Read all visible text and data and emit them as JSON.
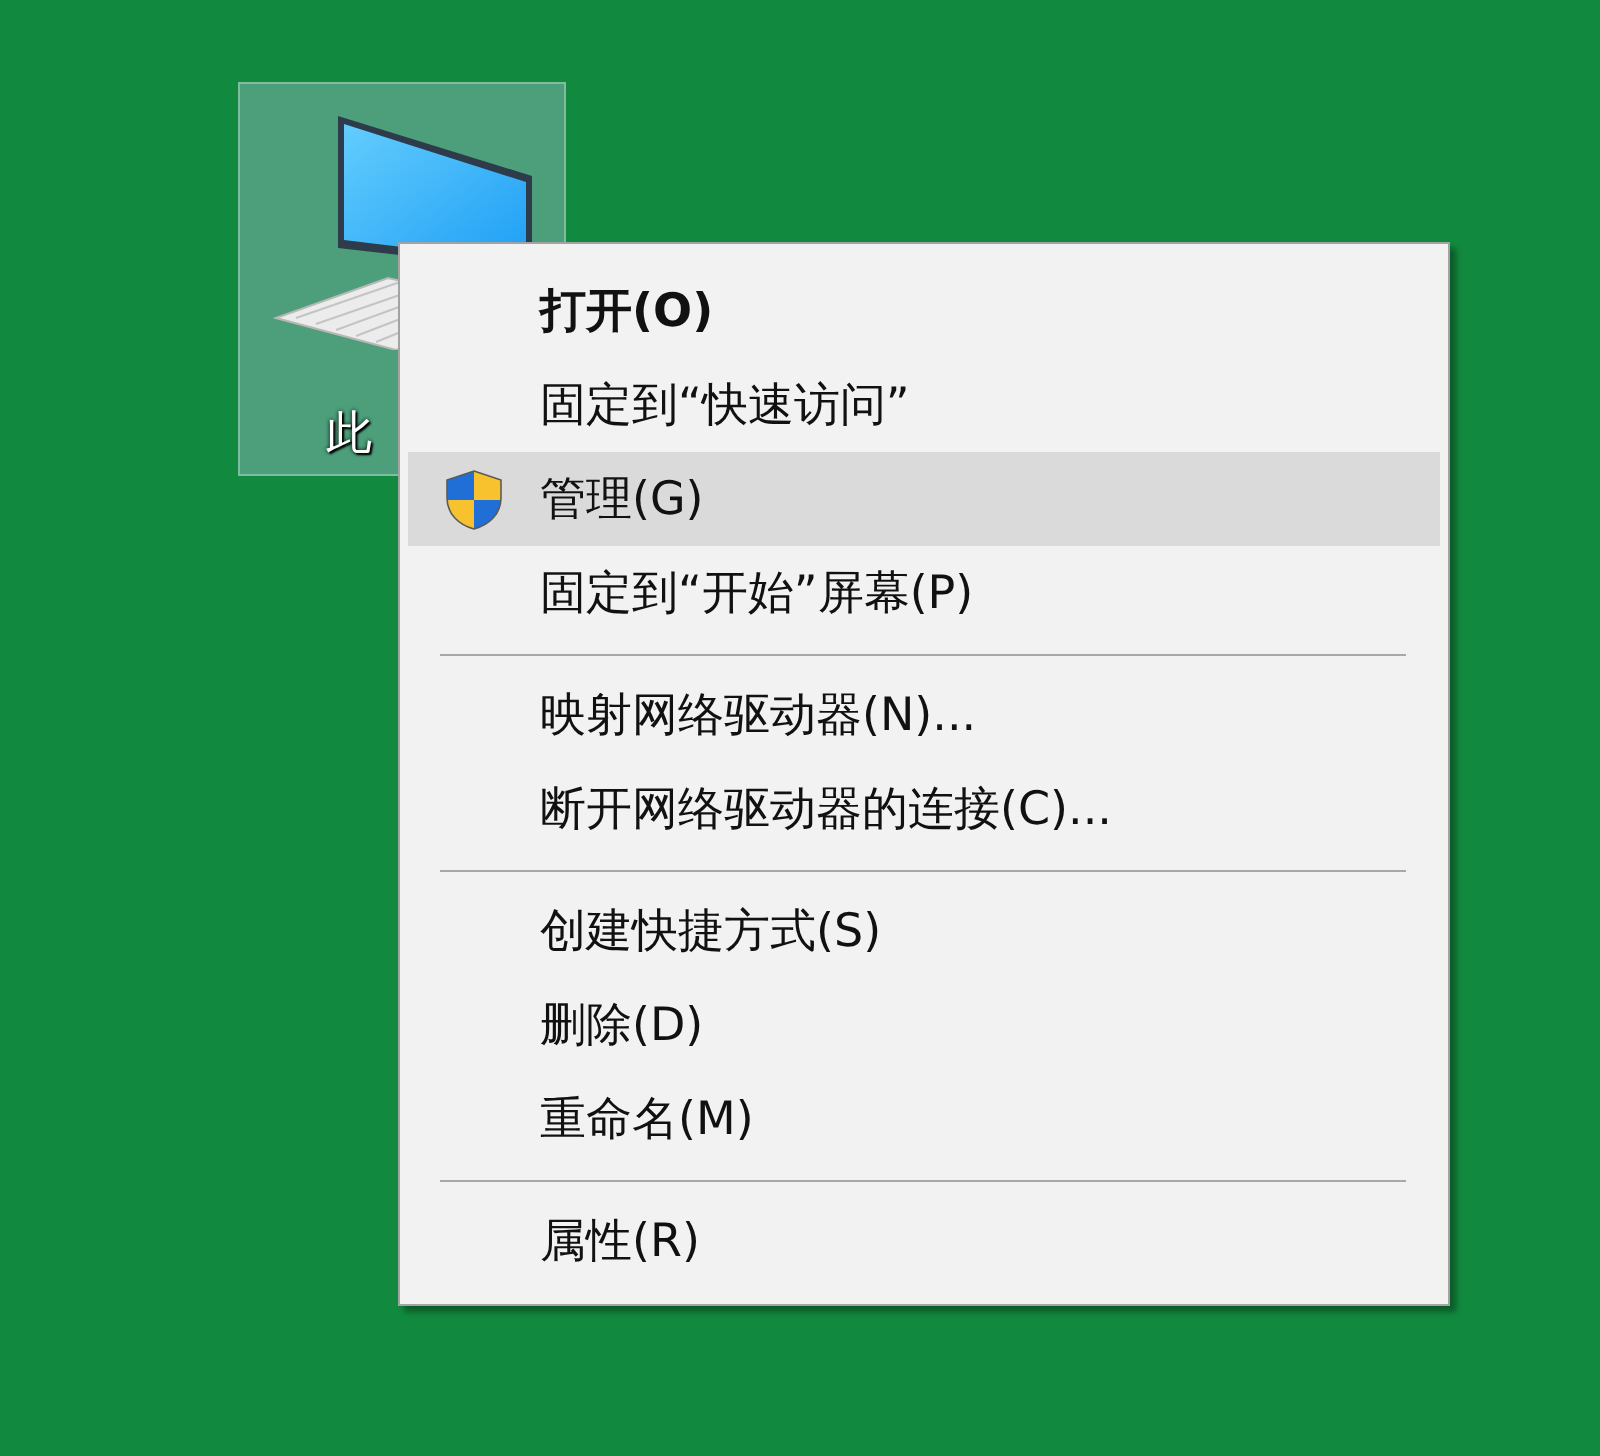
{
  "desktop": {
    "icons": [
      {
        "label": "此",
        "selected": true
      }
    ]
  },
  "context_menu": {
    "groups": [
      {
        "items": [
          {
            "label": "打开(O)",
            "default": true,
            "selected": false,
            "requires_admin": false
          },
          {
            "label": "固定到“快速访问”",
            "default": false,
            "selected": false,
            "requires_admin": false
          },
          {
            "label": "管理(G)",
            "default": false,
            "selected": true,
            "requires_admin": true
          },
          {
            "label": "固定到“开始”屏幕(P)",
            "default": false,
            "selected": false,
            "requires_admin": false
          }
        ]
      },
      {
        "items": [
          {
            "label": "映射网络驱动器(N)...",
            "default": false,
            "selected": false,
            "requires_admin": false
          },
          {
            "label": "断开网络驱动器的连接(C)...",
            "default": false,
            "selected": false,
            "requires_admin": false
          }
        ]
      },
      {
        "items": [
          {
            "label": "创建快捷方式(S)",
            "default": false,
            "selected": false,
            "requires_admin": false
          },
          {
            "label": "删除(D)",
            "default": false,
            "selected": false,
            "requires_admin": false
          },
          {
            "label": "重命名(M)",
            "default": false,
            "selected": false,
            "requires_admin": false
          }
        ]
      },
      {
        "items": [
          {
            "label": "属性(R)",
            "default": false,
            "selected": false,
            "requires_admin": false
          }
        ]
      }
    ]
  }
}
